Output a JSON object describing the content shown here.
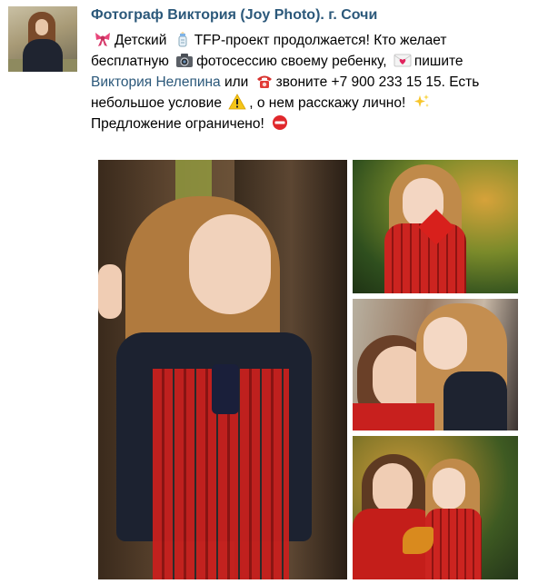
{
  "post": {
    "author": "Фотограф Виктория (Joy Photo). г. Сочи",
    "text": {
      "l1_a": "Детский",
      "l1_b": "TFP-проект продолжается! Кто желает",
      "l2_a": "бесплатную",
      "l2_b": "фотосессию своему ребенку,",
      "l2_c": "пишите",
      "l3_link": "Виктория Нелепина",
      "l3_b": "или",
      "l3_c": "звоните +7 900 233 15 15. Есть",
      "l4_a": "небольшое условие",
      "l4_b": ", о нем расскажу лично!",
      "l5_a": "Предложение ограничено!"
    },
    "icons": [
      "ribbon-icon",
      "baby-bottle-icon",
      "camera-icon",
      "love-letter-icon",
      "telephone-icon",
      "warning-icon",
      "sparkles-icon",
      "no-entry-icon"
    ]
  },
  "photos": [
    {
      "name": "girl-in-red-plaid-dress-by-tree"
    },
    {
      "name": "girl-in-red-dress-with-leaf"
    },
    {
      "name": "mother-and-daughter-hugging"
    },
    {
      "name": "mother-and-daughter-in-autumn-park"
    }
  ],
  "colors": {
    "link": "#2b587a",
    "text": "#000000",
    "background": "#ffffff"
  }
}
